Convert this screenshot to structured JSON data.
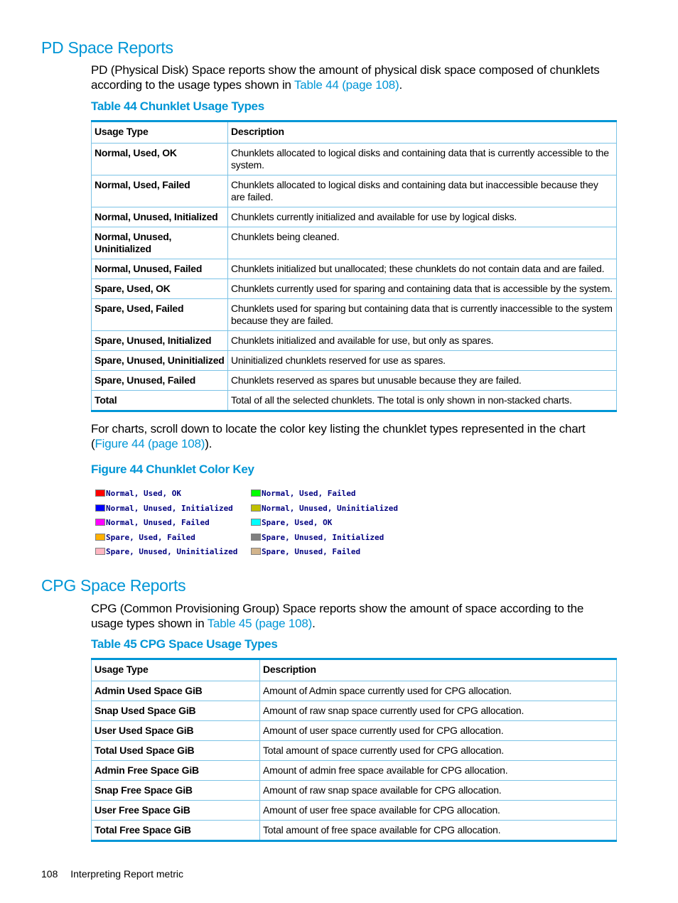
{
  "section1": {
    "heading": "PD Space Reports",
    "intro_before_link": "PD (Physical Disk) Space reports show the amount of physical disk space composed of chunklets according to the usage types shown in ",
    "intro_link": "Table 44 (page 108)",
    "intro_after_link": ".",
    "table_caption": "Table 44 Chunklet Usage Types",
    "table": {
      "headers": [
        "Usage Type",
        "Description"
      ],
      "rows": [
        {
          "type": "Normal, Used, OK",
          "description": "Chunklets allocated to logical disks and containing data that is currently accessible to the system."
        },
        {
          "type": "Normal, Used, Failed",
          "description": "Chunklets allocated to logical disks and containing data but inaccessible because they are failed."
        },
        {
          "type": "Normal, Unused, Initialized",
          "description": "Chunklets currently initialized and available for use by logical disks."
        },
        {
          "type": "Normal, Unused, Uninitialized",
          "description": "Chunklets being cleaned."
        },
        {
          "type": "Normal, Unused, Failed",
          "description": "Chunklets initialized but unallocated; these chunklets do not contain data and are failed."
        },
        {
          "type": "Spare, Used, OK",
          "description": "Chunklets currently used for sparing and containing data that is accessible by the system."
        },
        {
          "type": "Spare, Used, Failed",
          "description": "Chunklets used for sparing but containing data that is currently inaccessible to the system because they are failed."
        },
        {
          "type": "Spare, Unused, Initialized",
          "description": "Chunklets initialized and available for use, but only as spares."
        },
        {
          "type": "Spare, Unused, Uninitialized",
          "description": "Uninitialized chunklets reserved for use as spares."
        },
        {
          "type": "Spare, Unused, Failed",
          "description": "Chunklets reserved as spares but unusable because they are failed."
        },
        {
          "type": "Total",
          "description": "Total of all the selected chunklets. The total is only shown in non-stacked charts."
        }
      ]
    },
    "charts_note_before_link": "For charts, scroll down to locate the color key listing the chunklet types represented in the chart (",
    "charts_note_link": "Figure 44 (page 108)",
    "charts_note_after_link": ").",
    "figure_caption": "Figure 44 Chunklet Color Key",
    "color_key": [
      {
        "label": "Normal, Used, OK",
        "color": "#ff0000"
      },
      {
        "label": "Normal, Used, Failed",
        "color": "#00ff00"
      },
      {
        "label": "Normal, Unused, Initialized",
        "color": "#0000ff"
      },
      {
        "label": "Normal, Unused, Uninitialized",
        "color": "#c0c000"
      },
      {
        "label": "Normal, Unused, Failed",
        "color": "#ff00ff"
      },
      {
        "label": "Spare, Used, OK",
        "color": "#00ffff"
      },
      {
        "label": "Spare, Used, Failed",
        "color": "#ffb000"
      },
      {
        "label": "Spare, Unused, Initialized",
        "color": "#808080"
      },
      {
        "label": "Spare, Unused, Uninitialized",
        "color": "#ffb6c1"
      },
      {
        "label": "Spare, Unused, Failed",
        "color": "#d2b48c"
      }
    ]
  },
  "section2": {
    "heading": "CPG Space Reports",
    "intro_before_link": "CPG (Common Provisioning Group) Space reports show the amount of space according to the usage types shown in ",
    "intro_link": "Table 45 (page 108)",
    "intro_after_link": ".",
    "table_caption": "Table 45 CPG Space Usage Types",
    "table": {
      "headers": [
        "Usage Type",
        "Description"
      ],
      "rows": [
        {
          "type": "Admin Used Space GiB",
          "description": "Amount of Admin space currently used for CPG allocation."
        },
        {
          "type": "Snap Used Space GiB",
          "description": "Amount of raw snap space currently used for CPG allocation."
        },
        {
          "type": "User Used Space GiB",
          "description": "Amount of user space currently used for CPG allocation."
        },
        {
          "type": "Total Used Space GiB",
          "description": "Total amount of space currently used for CPG allocation."
        },
        {
          "type": "Admin Free Space GiB",
          "description": "Amount of admin free space available for CPG allocation."
        },
        {
          "type": "Snap Free Space GiB",
          "description": "Amount of raw snap space available for CPG allocation."
        },
        {
          "type": "User Free Space GiB",
          "description": "Amount of user free space available for CPG allocation."
        },
        {
          "type": "Total Free Space GiB",
          "description": "Total amount of free space available for CPG allocation."
        }
      ]
    }
  },
  "footer": {
    "page_number": "108",
    "section_title": "Interpreting Report metric"
  }
}
